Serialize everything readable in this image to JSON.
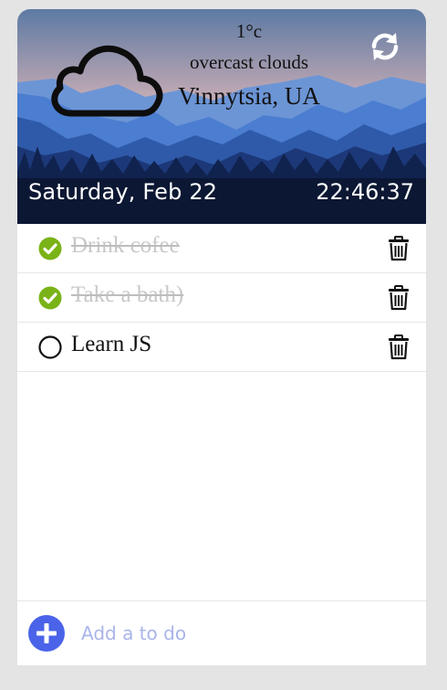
{
  "weather": {
    "temperature": "1°c",
    "description": "overcast clouds",
    "location": "Vinnytsia, UA",
    "icon": "cloud-icon"
  },
  "datetime": {
    "date": "Saturday, Feb 22",
    "time": "22:46:37"
  },
  "todos": [
    {
      "text": "Drink cofee",
      "done": true
    },
    {
      "text": "Take a bath)",
      "done": true
    },
    {
      "text": "Learn JS",
      "done": false
    }
  ],
  "add_todo": {
    "placeholder": "Add a to do",
    "value": ""
  },
  "colors": {
    "page_bg": "#e4e4e4",
    "check_done": "#7ab317",
    "add_button": "#4a63e8",
    "placeholder": "#a9b4ea"
  }
}
